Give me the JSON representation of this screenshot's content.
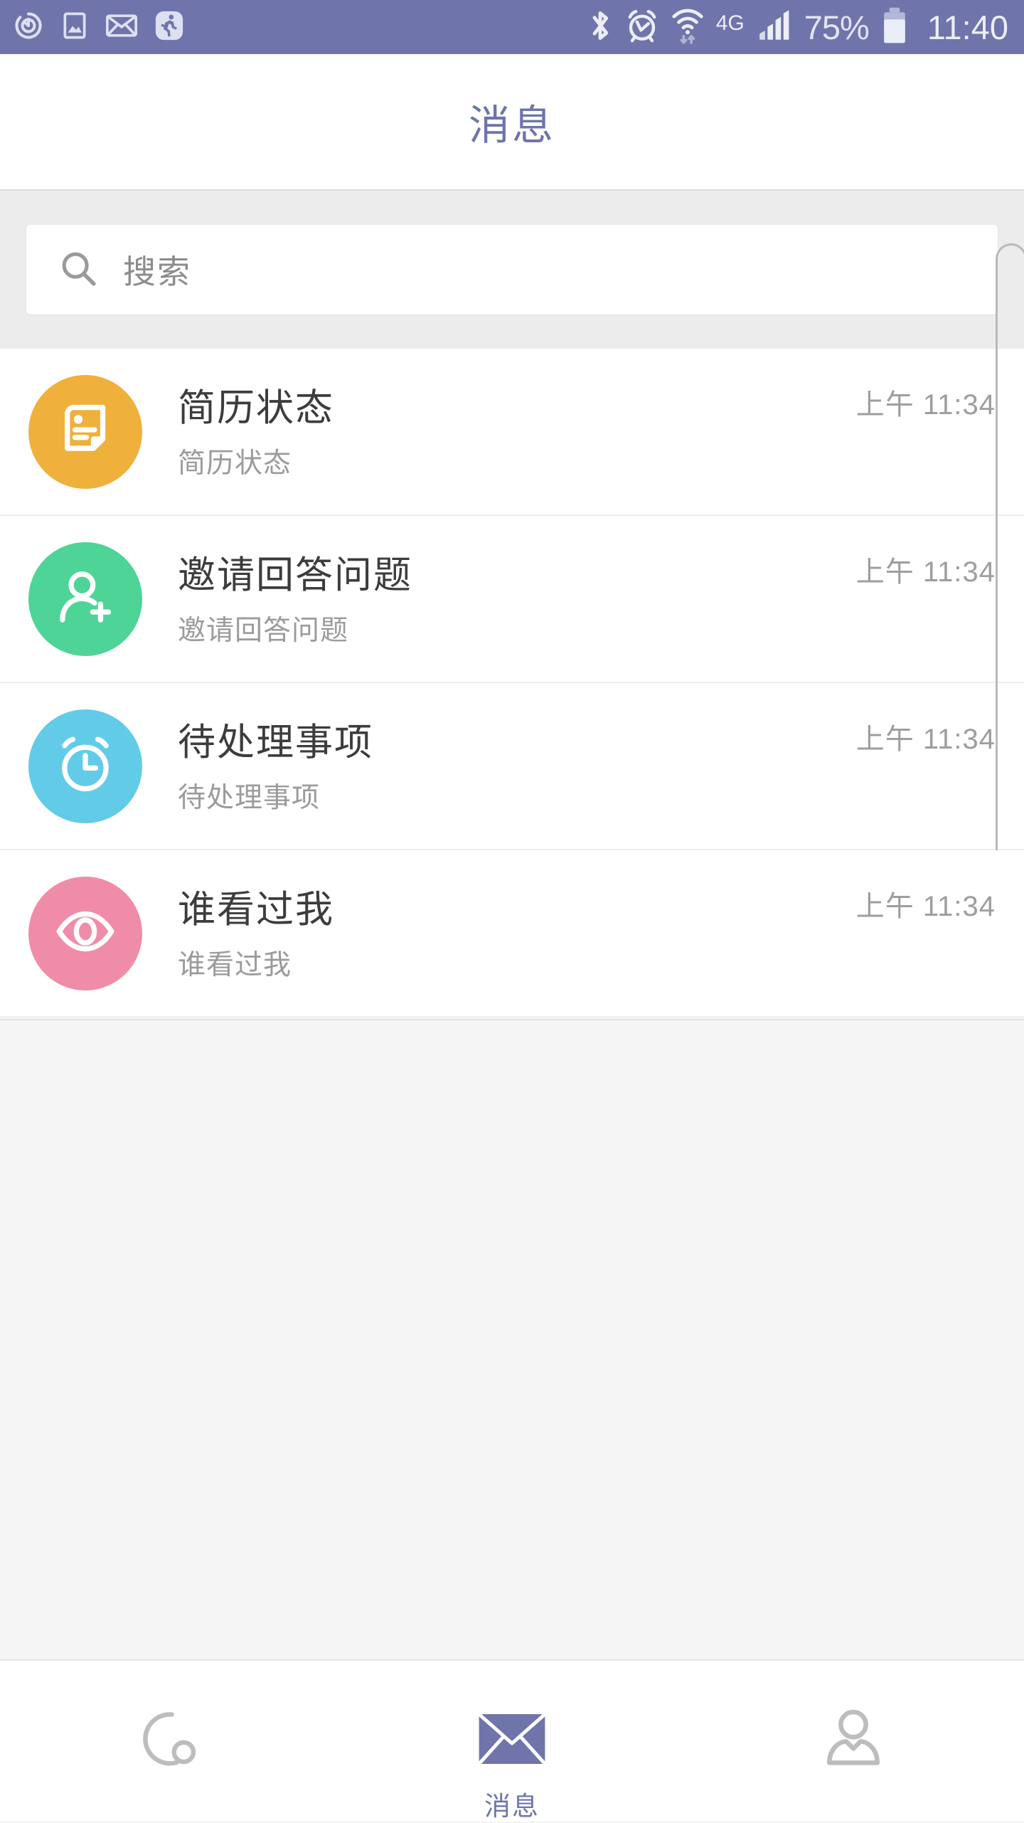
{
  "status_bar": {
    "background_color": "#6f74ab",
    "left_icons": [
      "sync-icon",
      "screenshot-image-icon",
      "mail-icon",
      "health-running-icon"
    ],
    "right_icons": [
      "bluetooth-icon",
      "alarm-icon",
      "wifi-icon",
      "signal-bars-icon",
      "battery-icon"
    ],
    "network_type": "4G",
    "battery_percent": "75%",
    "clock": "11:40"
  },
  "header": {
    "title": "消息",
    "title_color": "#6f74ab"
  },
  "search": {
    "placeholder": "搜索",
    "value": "",
    "icon": "search-icon"
  },
  "messages": [
    {
      "icon": "resume-document-icon",
      "avatar_color": "#f0b03c",
      "title": "简历状态",
      "subtitle": "简历状态",
      "time": "上午 11:34"
    },
    {
      "icon": "person-add-icon",
      "avatar_color": "#4ed496",
      "title": "邀请回答问题",
      "subtitle": "邀请回答问题",
      "time": "上午 11:34"
    },
    {
      "icon": "alarm-clock-icon",
      "avatar_color": "#62cbe8",
      "title": "待处理事项",
      "subtitle": "待处理事项",
      "time": "上午 11:34"
    },
    {
      "icon": "eye-icon",
      "avatar_color": "#ef8da8",
      "title": "谁看过我",
      "subtitle": "谁看过我",
      "time": "上午 11:34"
    }
  ],
  "bottom_nav": {
    "active_color": "#6f74ab",
    "inactive_color": "#bdbdbd",
    "items": [
      {
        "icon": "discover-circle-icon",
        "label": "",
        "active": false
      },
      {
        "icon": "envelope-icon",
        "label": "消息",
        "active": true
      },
      {
        "icon": "person-profile-icon",
        "label": "",
        "active": false
      }
    ]
  }
}
